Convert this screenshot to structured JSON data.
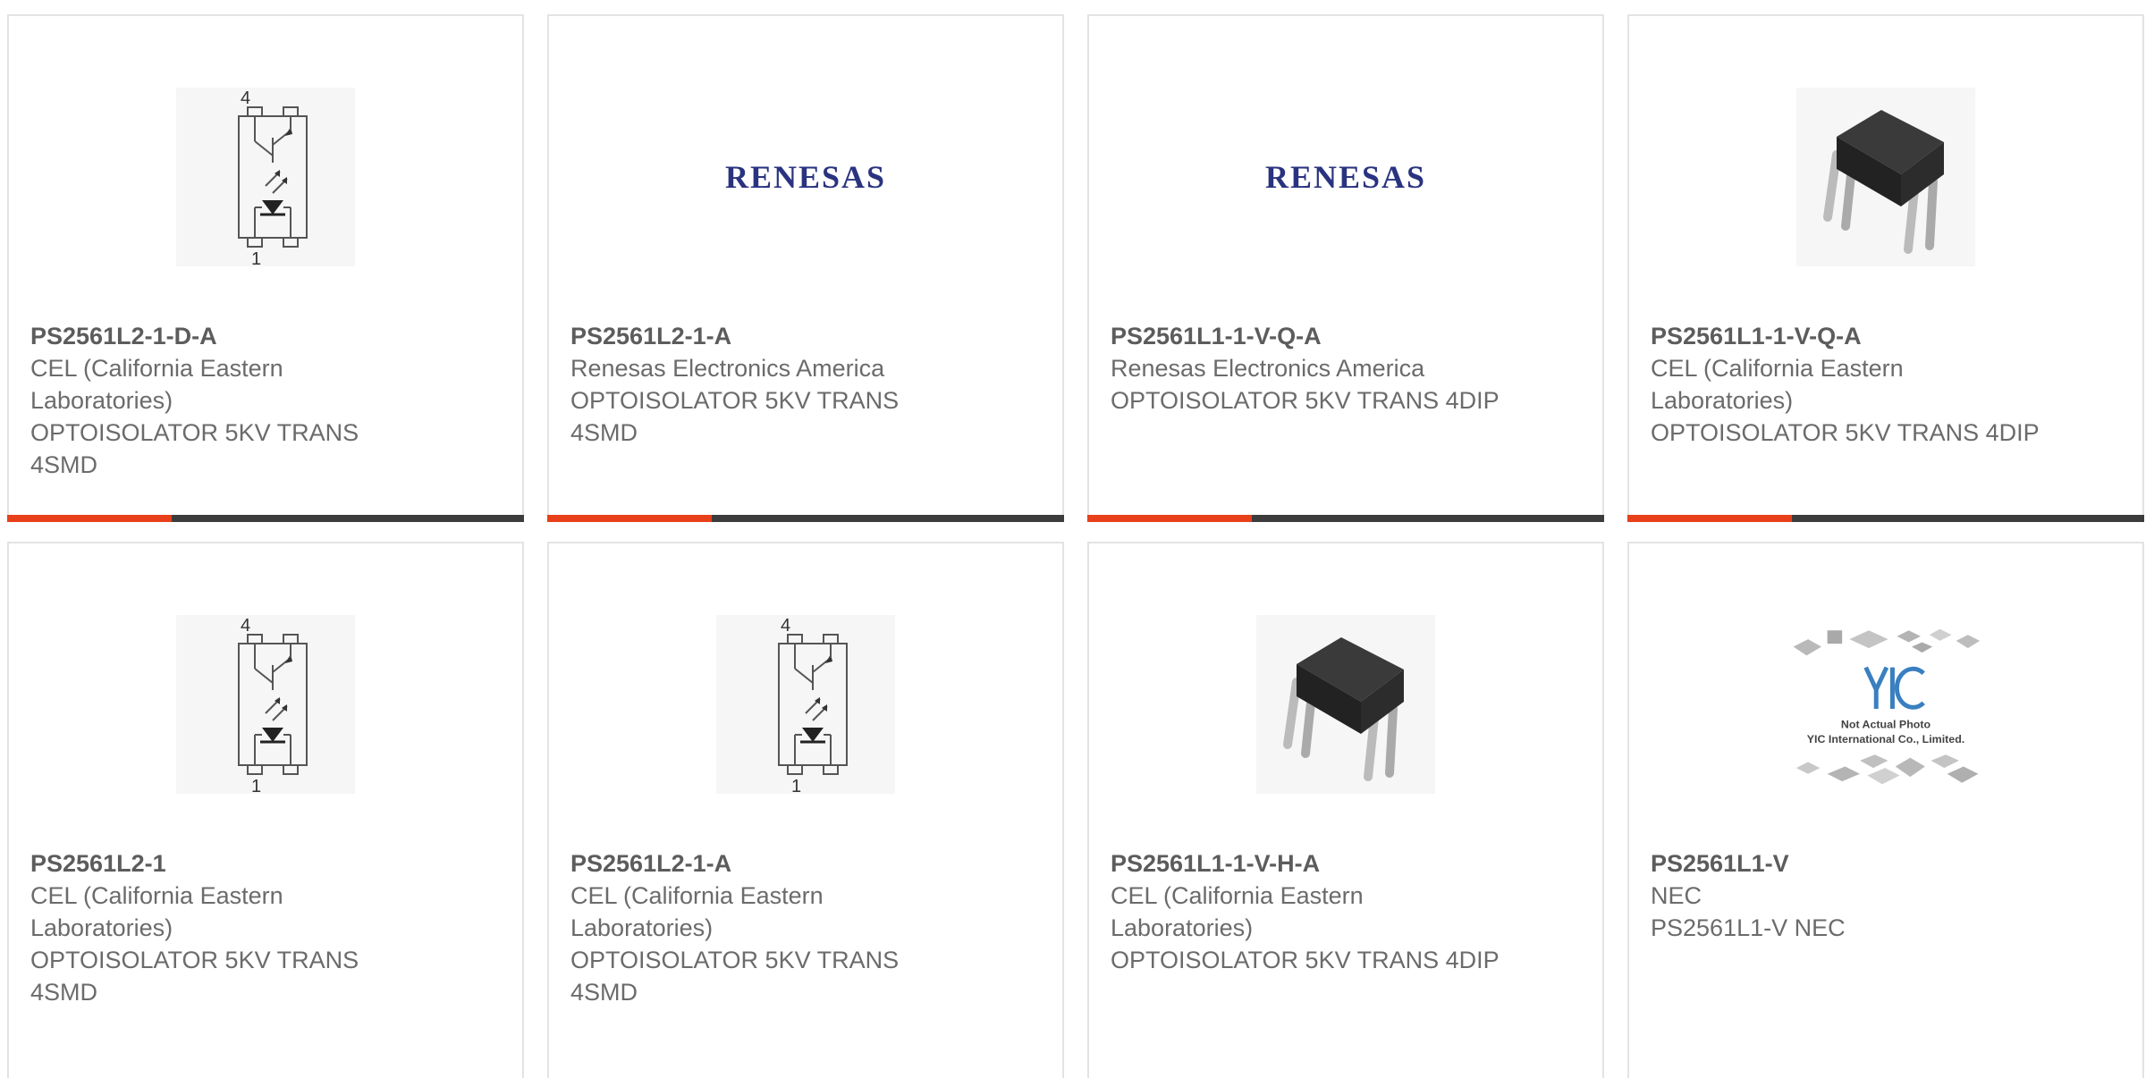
{
  "colors": {
    "accent": "#e8401a",
    "bar": "#3c3c3c",
    "renesas_logo": "#2a3380",
    "text": "#6b6b6b",
    "border": "#e3e3e3"
  },
  "products": [
    {
      "part": "PS2561L2-1-D-A",
      "manufacturer": "CEL (California Eastern Laboratories)",
      "description": "OPTOISOLATOR 5KV TRANS 4SMD",
      "image": "optoisolator-schematic-icon"
    },
    {
      "part": "PS2561L2-1-A",
      "manufacturer": "Renesas Electronics America",
      "description": "OPTOISOLATOR 5KV TRANS 4SMD",
      "image": "renesas-logo",
      "logo_text": "RENESAS"
    },
    {
      "part": "PS2561L1-1-V-Q-A",
      "manufacturer": "Renesas Electronics America",
      "description": "OPTOISOLATOR 5KV TRANS 4DIP",
      "image": "renesas-logo",
      "logo_text": "RENESAS"
    },
    {
      "part": "PS2561L1-1-V-Q-A",
      "manufacturer": "CEL (California Eastern Laboratories)",
      "description": "OPTOISOLATOR 5KV TRANS 4DIP",
      "image": "dip-chip-photo-icon"
    },
    {
      "part": "PS2561L2-1",
      "manufacturer": "CEL (California Eastern Laboratories)",
      "description": "OPTOISOLATOR 5KV TRANS 4SMD",
      "image": "optoisolator-schematic-icon"
    },
    {
      "part": "PS2561L2-1-A",
      "manufacturer": "CEL (California Eastern Laboratories)",
      "description": "OPTOISOLATOR 5KV TRANS 4SMD",
      "image": "optoisolator-schematic-icon"
    },
    {
      "part": "PS2561L1-1-V-H-A",
      "manufacturer": "CEL (California Eastern Laboratories)",
      "description": "OPTOISOLATOR 5KV TRANS 4DIP",
      "image": "dip-chip-photo-icon"
    },
    {
      "part": "PS2561L1-V",
      "manufacturer": "NEC",
      "description": "PS2561L1-V NEC",
      "image": "yic-placeholder-icon",
      "placeholder_line1": "Not Actual Photo",
      "placeholder_line2": "YIC International Co., Limited."
    }
  ],
  "schematic_labels": {
    "pin_top": "4",
    "pin_bottom": "1"
  }
}
